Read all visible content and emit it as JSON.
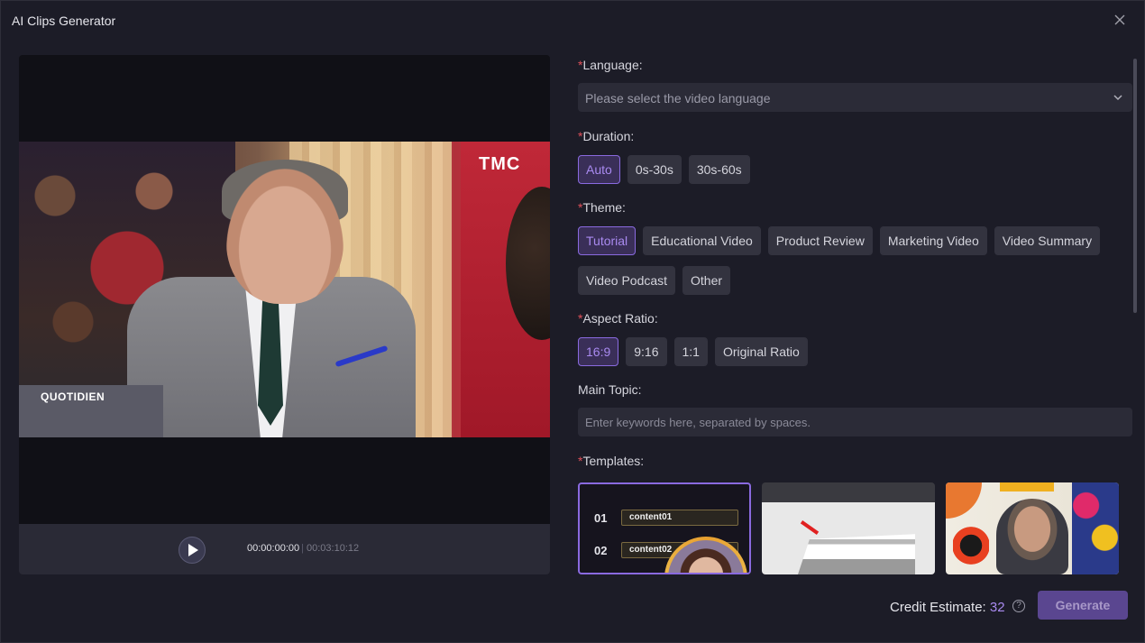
{
  "window": {
    "title": "AI Clips Generator"
  },
  "preview": {
    "overlay_brand_right": "TMC",
    "overlay_brand_left": "QUOTIDIEN",
    "time_current": "00:00:00:00",
    "time_separator": "|",
    "time_total": "00:03:10:12"
  },
  "language": {
    "required": "*",
    "label": "Language:",
    "placeholder": "Please select the video language"
  },
  "duration": {
    "required": "*",
    "label": "Duration:",
    "options": [
      "Auto",
      "0s-30s",
      "30s-60s"
    ],
    "selected": "Auto"
  },
  "theme": {
    "required": "*",
    "label": "Theme:",
    "options": [
      "Tutorial",
      "Educational Video",
      "Product Review",
      "Marketing Video",
      "Video Summary",
      "Video Podcast",
      "Other"
    ],
    "selected": "Tutorial"
  },
  "aspect": {
    "required": "*",
    "label": "Aspect Ratio:",
    "options": [
      "16:9",
      "9:16",
      "1:1",
      "Original Ratio"
    ],
    "selected": "16:9"
  },
  "topic": {
    "label": "Main Topic:",
    "placeholder": "Enter keywords here, separated by spaces."
  },
  "templates": {
    "required": "*",
    "label": "Templates:",
    "tpl1": {
      "row1_num": "01",
      "row1_text": "content01",
      "row2_num": "02",
      "row2_text": "content02"
    }
  },
  "footer": {
    "credit_label": "Credit Estimate: ",
    "credit_value": "32",
    "help": "?",
    "generate": "Generate"
  },
  "colors": {
    "accent": "#8a6ae0",
    "required": "#e0505a",
    "background": "#1c1c27"
  }
}
